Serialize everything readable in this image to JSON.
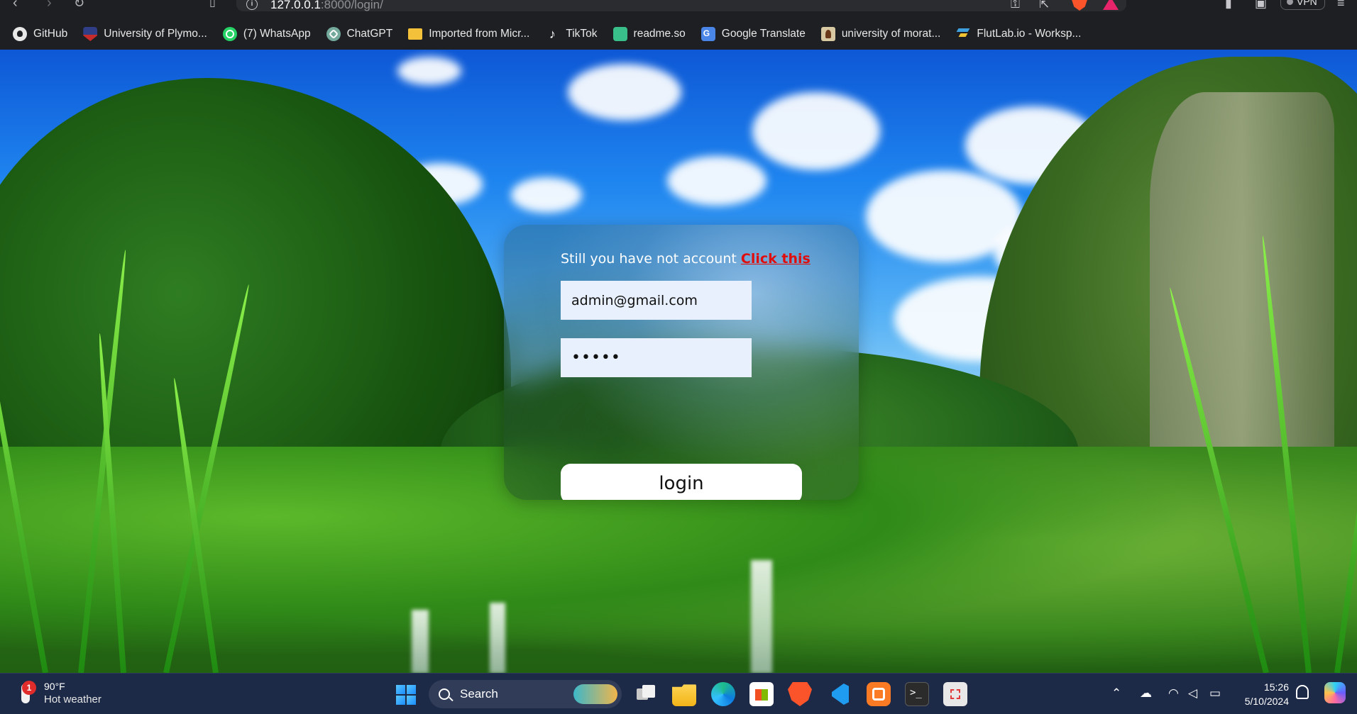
{
  "browser": {
    "url_host": "127.0.0.1",
    "url_rest": ":8000/login/",
    "vpn_label": "VPN"
  },
  "bookmarks": [
    {
      "label": "GitHub",
      "icon": "github-icon"
    },
    {
      "label": "University of Plymo...",
      "icon": "university-crest-icon"
    },
    {
      "label": "(7) WhatsApp",
      "icon": "whatsapp-icon"
    },
    {
      "label": "ChatGPT",
      "icon": "chatgpt-icon"
    },
    {
      "label": "Imported from Micr...",
      "icon": "folder-icon"
    },
    {
      "label": "TikTok",
      "icon": "tiktok-icon"
    },
    {
      "label": "readme.so",
      "icon": "readme-icon"
    },
    {
      "label": "Google Translate",
      "icon": "google-translate-icon"
    },
    {
      "label": "university of morat...",
      "icon": "university-logo-icon"
    },
    {
      "label": "FlutLab.io - Worksp...",
      "icon": "flutlab-icon"
    }
  ],
  "login": {
    "prompt_text": "Still you have not account ",
    "signup_link": "Click this",
    "email_value": "admin@gmail.com",
    "password_value": "•••••",
    "button_label": "login"
  },
  "taskbar": {
    "weather_temp": "90°F",
    "weather_desc": "Hot weather",
    "weather_badge": "1",
    "search_label": "Search",
    "time": "15:26",
    "date": "5/10/2024"
  },
  "colors": {
    "link_red": "#e00d0d",
    "input_bg": "#e8f0fe",
    "taskbar_bg": "#1c2a47",
    "browser_bg": "#1e1f22"
  }
}
